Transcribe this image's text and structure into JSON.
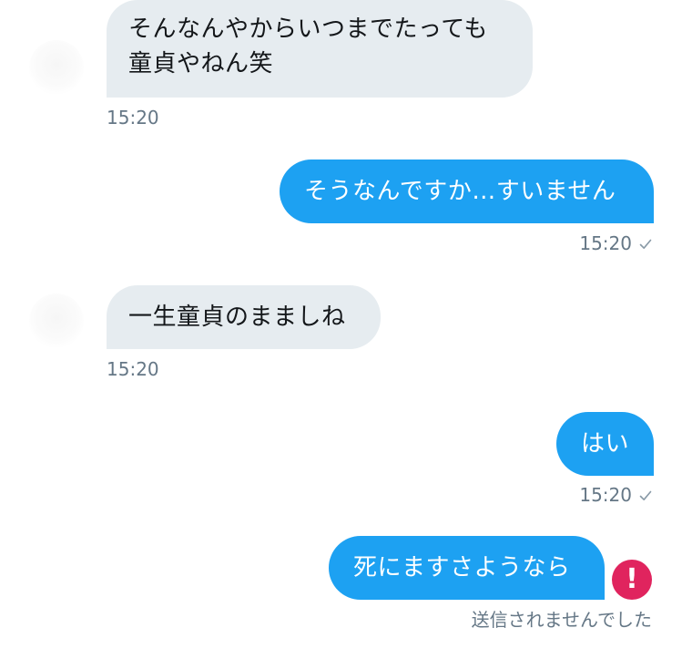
{
  "conversation": {
    "messages": [
      {
        "direction": "incoming",
        "lines": [
          "そんなんやからいつまでたっても",
          "童貞やねん笑"
        ],
        "time": "15:20"
      },
      {
        "direction": "outgoing",
        "lines": [
          "そうなんですか…すいません"
        ],
        "time": "15:20",
        "status_icon": "checkmark-icon"
      },
      {
        "direction": "incoming",
        "lines": [
          "一生童貞のまましね"
        ],
        "time": "15:20"
      },
      {
        "direction": "outgoing",
        "lines": [
          "はい"
        ],
        "time": "15:20",
        "status_icon": "checkmark-icon"
      },
      {
        "direction": "outgoing",
        "lines": [
          "死にますさようなら"
        ],
        "error_icon": "exclamation-icon",
        "error_glyph": "!",
        "failed_note": "送信されませんでした"
      }
    ]
  },
  "colors": {
    "incoming_bubble": "#e6ecf0",
    "outgoing_bubble": "#1da1f2",
    "timestamp": "#657786",
    "error": "#e0245e"
  }
}
